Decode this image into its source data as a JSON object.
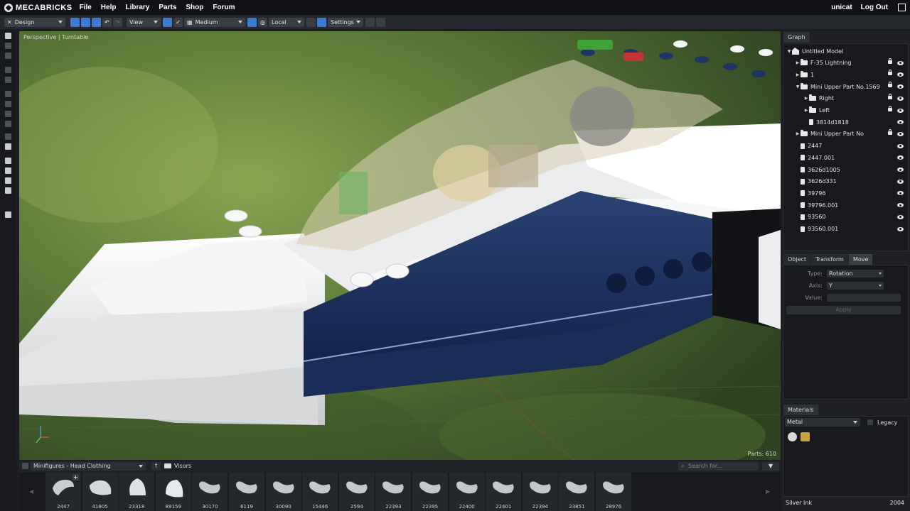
{
  "app": {
    "logo_text": "MECABRICKS"
  },
  "menu": {
    "items": [
      "File",
      "Help",
      "Library",
      "Parts",
      "Shop",
      "Forum"
    ],
    "user": "unicat",
    "logout": "Log Out"
  },
  "toolbar": {
    "mode": "Design",
    "view": "View",
    "quality": "Medium",
    "space": "Local",
    "settings": "Settings"
  },
  "viewport": {
    "label": "Perspective | Turntable",
    "parts_count": "Parts: 610"
  },
  "graph": {
    "tab": "Graph",
    "rows": [
      {
        "label": "Untitled Model",
        "indent": 0,
        "icon": "model",
        "arrow": "down",
        "lock": false,
        "eye": false
      },
      {
        "label": "F-35 Lightning",
        "indent": 1,
        "icon": "folder",
        "arrow": "right",
        "lock": true,
        "eye": true
      },
      {
        "label": "1",
        "indent": 1,
        "icon": "folder",
        "arrow": "right",
        "lock": true,
        "eye": true
      },
      {
        "label": "Mini Upper Part No.1569",
        "indent": 1,
        "icon": "folder",
        "arrow": "down",
        "lock": true,
        "eye": true
      },
      {
        "label": "Right",
        "indent": 2,
        "icon": "folder",
        "arrow": "right",
        "lock": true,
        "eye": true
      },
      {
        "label": "Left",
        "indent": 2,
        "icon": "folder",
        "arrow": "right",
        "lock": true,
        "eye": true
      },
      {
        "label": "3814d1818",
        "indent": 2,
        "icon": "part",
        "arrow": "",
        "lock": false,
        "eye": true
      },
      {
        "label": "Mini Upper Part No",
        "indent": 1,
        "icon": "folder",
        "arrow": "right",
        "lock": true,
        "eye": true
      },
      {
        "label": "2447",
        "indent": 1,
        "icon": "part",
        "arrow": "",
        "lock": false,
        "eye": true
      },
      {
        "label": "2447.001",
        "indent": 1,
        "icon": "part",
        "arrow": "",
        "lock": false,
        "eye": true
      },
      {
        "label": "3626d1005",
        "indent": 1,
        "icon": "part",
        "arrow": "",
        "lock": false,
        "eye": true
      },
      {
        "label": "3626d331",
        "indent": 1,
        "icon": "part",
        "arrow": "",
        "lock": false,
        "eye": true
      },
      {
        "label": "39796",
        "indent": 1,
        "icon": "part",
        "arrow": "",
        "lock": false,
        "eye": true
      },
      {
        "label": "39796.001",
        "indent": 1,
        "icon": "part",
        "arrow": "",
        "lock": false,
        "eye": true
      },
      {
        "label": "93560",
        "indent": 1,
        "icon": "part",
        "arrow": "",
        "lock": false,
        "eye": true
      },
      {
        "label": "93560.001",
        "indent": 1,
        "icon": "part",
        "arrow": "",
        "lock": false,
        "eye": true
      }
    ]
  },
  "props": {
    "tabs": [
      "Object",
      "Transform",
      "Move"
    ],
    "active_tab": "Move",
    "type_label": "Type:",
    "type_value": "Rotation",
    "axis_label": "Axis:",
    "axis_value": "Y",
    "value_label": "Value:",
    "value_value": "",
    "apply": "Apply"
  },
  "materials": {
    "tab": "Materials",
    "type": "Metal",
    "legacy": "Legacy",
    "swatches": [
      "#d8d8d8",
      "#c9a142"
    ],
    "selected_name": "Silver Ink",
    "selected_id": "2004"
  },
  "library": {
    "category": "Minifigures - Head Clothing",
    "folder": "Visors",
    "search_placeholder": "Search for...",
    "parts": [
      "2447",
      "41805",
      "23318",
      "89159",
      "30170",
      "6119",
      "30090",
      "15446",
      "2594",
      "22393",
      "22395",
      "22400",
      "22401",
      "22394",
      "23851",
      "28976"
    ]
  },
  "colors": {
    "accent": "#3d7ad6",
    "bg": "#1b1d21",
    "dark_blue": "#1f3566",
    "white_brick": "#eceef0"
  }
}
